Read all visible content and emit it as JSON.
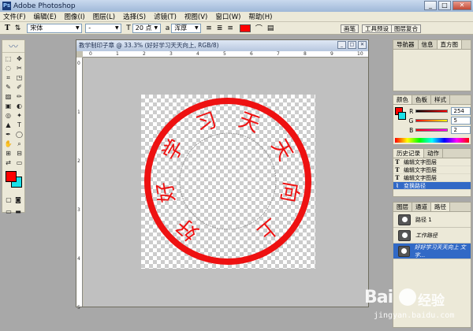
{
  "app": {
    "title": "Adobe Photoshop"
  },
  "menu": [
    "文件(F)",
    "编辑(E)",
    "图像(I)",
    "图层(L)",
    "选择(S)",
    "滤镜(T)",
    "视图(V)",
    "窗口(W)",
    "帮助(H)"
  ],
  "options": {
    "tool_glyph": "T",
    "font_family": "宋体",
    "font_style": "-",
    "font_size": "20 点",
    "aa_label": "a",
    "aa_mode": "浑厚",
    "text_color": "#ff0000",
    "tabs": [
      "画笔",
      "工具预设",
      "图层复合"
    ]
  },
  "toolbox": {
    "tools": [
      "⬚",
      "✥",
      "◌",
      "✂",
      "⌗",
      "◳",
      "✎",
      "✐",
      "▨",
      "✏",
      "▣",
      "◐",
      "◎",
      "✦",
      "▲",
      "T",
      "✒",
      "◯",
      "✋",
      "⌕",
      "⊞",
      "⊟",
      "⇄",
      "▭"
    ],
    "fg_color": "#ff0000",
    "bg_color": "#1ae0e8"
  },
  "document": {
    "title": "教学制印子章 @ 33.3% (好好学习天天向上, RGB/8)",
    "ruler_top": [
      "0",
      "1",
      "2",
      "3",
      "4",
      "5",
      "6",
      "7",
      "8",
      "9",
      "10"
    ],
    "ruler_left": [
      "0",
      "1",
      "2",
      "3",
      "4",
      "5"
    ],
    "seal_text": [
      "好",
      "好",
      "学",
      "习",
      "天",
      "天",
      "向",
      "上"
    ],
    "seal_color": "#ee1111"
  },
  "navigator_panel": {
    "tabs": [
      "导航器",
      "信息",
      "直方图"
    ]
  },
  "color_panel": {
    "tabs": [
      "颜色",
      "色板",
      "样式"
    ],
    "channels": [
      {
        "label": "R",
        "value": "254"
      },
      {
        "label": "G",
        "value": "5"
      },
      {
        "label": "B",
        "value": "2"
      }
    ]
  },
  "history_panel": {
    "tabs": [
      "历史记录",
      "动作"
    ],
    "items": [
      "编辑文字图层",
      "编辑文字图层",
      "编辑文字图层",
      "变换路径"
    ]
  },
  "paths_panel": {
    "tabs": [
      "图层",
      "通道",
      "路径"
    ],
    "rows": [
      "路径 1",
      "工作路径",
      "好好学习天天向上 文字..."
    ]
  },
  "watermark": {
    "brand": "Bai",
    "brand2": "经验",
    "url": "jingyan.baidu.com"
  }
}
